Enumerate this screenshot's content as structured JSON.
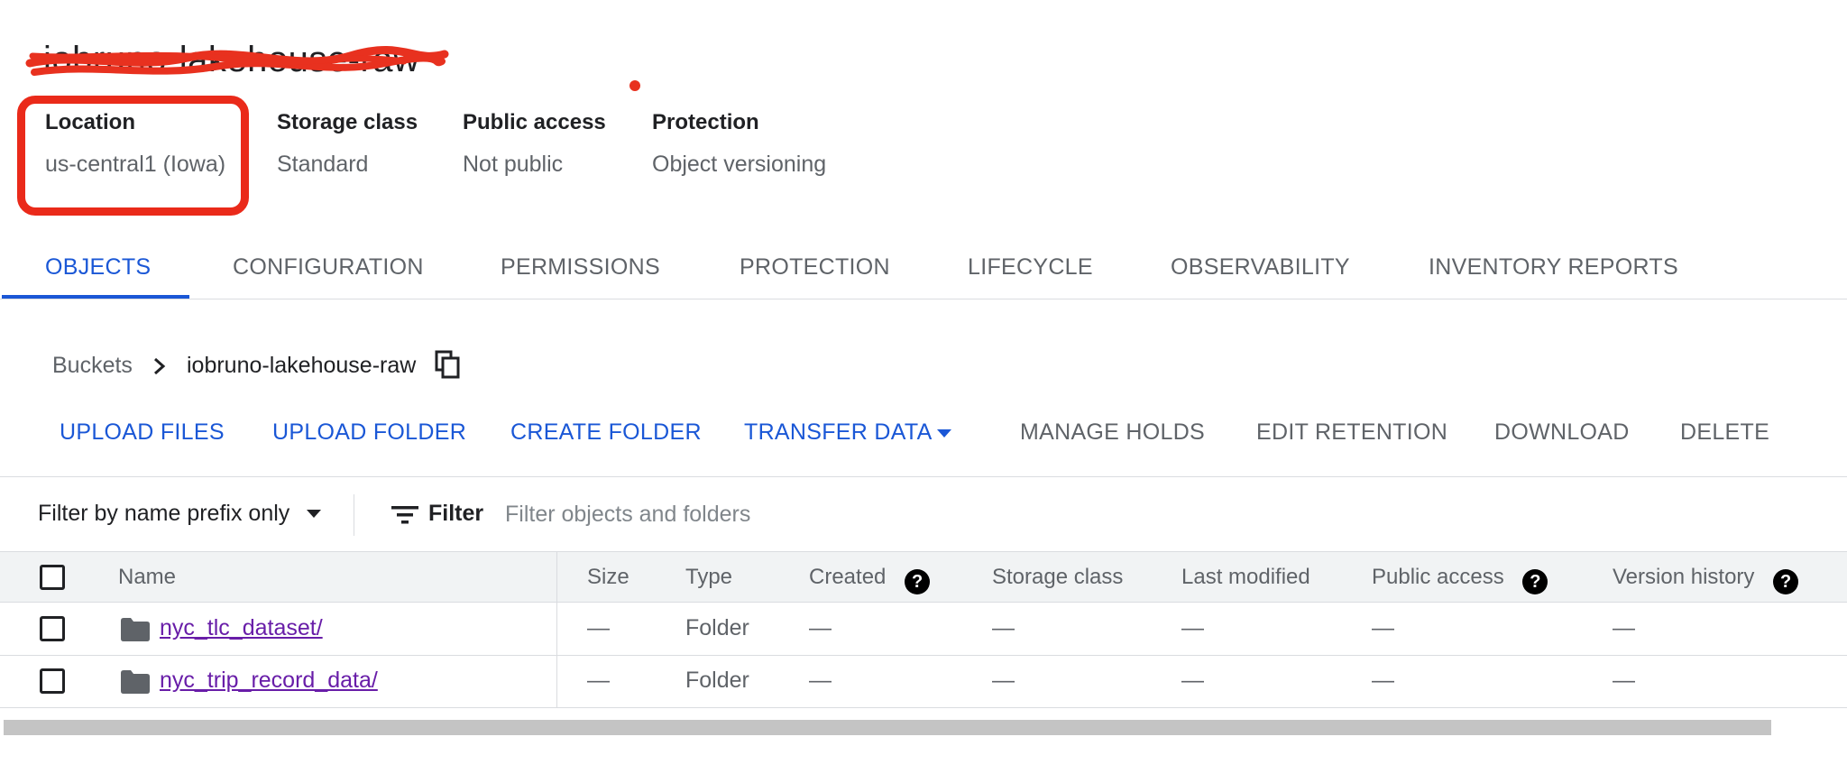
{
  "bucket": {
    "title": "iobruno-lakehouse-raw"
  },
  "summary": [
    {
      "label": "Location",
      "value": "us-central1 (Iowa)"
    },
    {
      "label": "Storage class",
      "value": "Standard"
    },
    {
      "label": "Public access",
      "value": "Not public"
    },
    {
      "label": "Protection",
      "value": "Object versioning"
    }
  ],
  "tabs": [
    {
      "label": "OBJECTS",
      "active": true
    },
    {
      "label": "CONFIGURATION"
    },
    {
      "label": "PERMISSIONS"
    },
    {
      "label": "PROTECTION"
    },
    {
      "label": "LIFECYCLE"
    },
    {
      "label": "OBSERVABILITY"
    },
    {
      "label": "INVENTORY REPORTS"
    }
  ],
  "breadcrumb": {
    "root": "Buckets",
    "current": "iobruno-lakehouse-raw",
    "separator_icon": "chevron-right-icon",
    "copy_icon": "copy-icon"
  },
  "actions": [
    {
      "label": "UPLOAD FILES",
      "enabled": true
    },
    {
      "label": "UPLOAD FOLDER",
      "enabled": true
    },
    {
      "label": "CREATE FOLDER",
      "enabled": true
    },
    {
      "label": "TRANSFER DATA",
      "enabled": true,
      "dropdown": true
    },
    {
      "label": "MANAGE HOLDS",
      "enabled": false
    },
    {
      "label": "EDIT RETENTION",
      "enabled": false
    },
    {
      "label": "DOWNLOAD",
      "enabled": false
    },
    {
      "label": "DELETE",
      "enabled": false
    }
  ],
  "filter": {
    "mode": "Filter by name prefix only",
    "label": "Filter",
    "placeholder": "Filter objects and folders"
  },
  "table": {
    "columns": [
      "Name",
      "Size",
      "Type",
      "Created",
      "Storage class",
      "Last modified",
      "Public access",
      "Version history"
    ],
    "rows": [
      {
        "name": "nyc_tlc_dataset/",
        "size": "—",
        "type": "Folder",
        "created": "—",
        "storage_class": "—",
        "last_modified": "—",
        "public_access": "—",
        "version_history": "—"
      },
      {
        "name": "nyc_trip_record_data/",
        "size": "—",
        "type": "Folder",
        "created": "—",
        "storage_class": "—",
        "last_modified": "—",
        "public_access": "—",
        "version_history": "—"
      }
    ]
  },
  "colors": {
    "accent": "#1a57d6",
    "link_visited": "#681da8",
    "annotation_red": "#ea2a1a"
  }
}
